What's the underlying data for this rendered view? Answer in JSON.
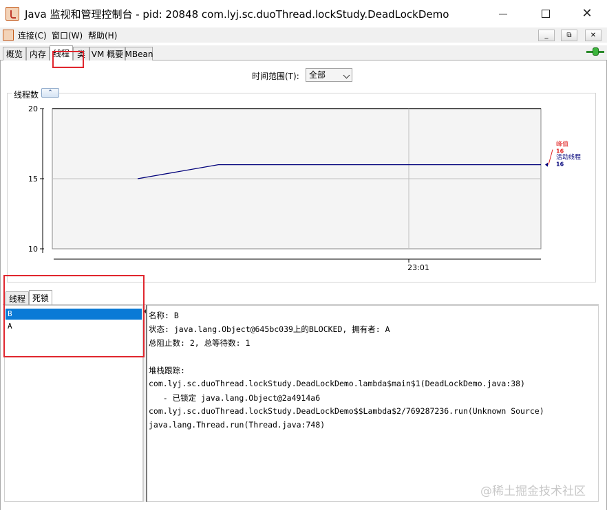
{
  "window": {
    "title": "Java 监视和管理控制台 - pid: 20848 com.lyj.sc.duoThread.lockStudy.DeadLockDemo",
    "min_symbol": "",
    "max_symbol": "",
    "close_symbol": "✕"
  },
  "menu": {
    "items": [
      {
        "label": "连接(C)"
      },
      {
        "label": "窗口(W)"
      },
      {
        "label": "帮助(H)"
      }
    ],
    "mdi_buttons": [
      "_",
      "⧉",
      "✕"
    ]
  },
  "tabs": [
    {
      "label": "概览"
    },
    {
      "label": "内存"
    },
    {
      "label": "线程"
    },
    {
      "label": "类"
    },
    {
      "label": "VM 概要"
    },
    {
      "label": "MBean"
    }
  ],
  "time_range": {
    "label": "时间范围(T):",
    "value": "全部"
  },
  "chart_title": "线程数",
  "collapse_symbol": "⌃",
  "chart_data": {
    "type": "line",
    "title": "线程数",
    "x_ticks": [
      "23:01"
    ],
    "y_ticks": [
      10,
      15,
      20
    ],
    "ylim": [
      10,
      20
    ],
    "grid": true,
    "series": [
      {
        "name": "活动线程",
        "color": "#00007a",
        "points": [
          [
            0.0,
            15
          ],
          [
            0.2,
            16
          ],
          [
            1.0,
            16
          ]
        ]
      }
    ],
    "legend": {
      "peak_label": "峰值",
      "peak_value": "16",
      "live_label": "活动线程",
      "live_value": "16",
      "peak_color": "#e02020",
      "live_color": "#00007a"
    }
  },
  "lower_tabs": [
    {
      "label": "线程"
    },
    {
      "label": "死锁"
    }
  ],
  "deadlock_threads": [
    {
      "name": "B"
    },
    {
      "name": "A"
    }
  ],
  "detail": {
    "lines": [
      "名称: B",
      "状态: java.lang.Object@645bc039上的BLOCKED, 拥有者: A",
      "总阻止数: 2, 总等待数: 1",
      "",
      "堆栈跟踪:",
      "com.lyj.sc.duoThread.lockStudy.DeadLockDemo.lambda$main$1(DeadLockDemo.java:38)",
      "   - 已锁定 java.lang.Object@2a4914a6",
      "com.lyj.sc.duoThread.lockStudy.DeadLockDemo$$Lambda$2/769287236.run(Unknown Source)",
      "java.lang.Thread.run(Thread.java:748)"
    ]
  },
  "watermark": "@稀土掘金技术社区"
}
